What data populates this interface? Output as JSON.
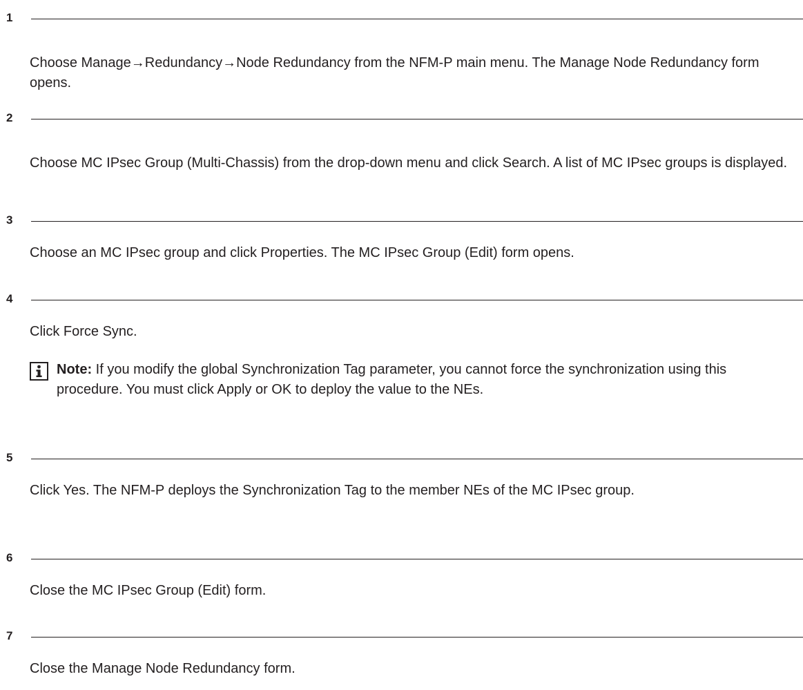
{
  "steps": [
    {
      "number": "1",
      "text": "Choose Manage→Redundancy→Node Redundancy from the NFM-P main menu. The Manage Node Redundancy form opens."
    },
    {
      "number": "2",
      "text": "Choose MC IPsec Group (Multi-Chassis) from the drop-down menu and click Search. A list of MC IPsec groups is displayed."
    },
    {
      "number": "3",
      "text": "Choose an MC IPsec group and click Properties. The MC IPsec Group (Edit) form opens."
    },
    {
      "number": "4",
      "text": "Click Force Sync.",
      "note": {
        "icon": "info-icon",
        "label": "Note:",
        "text": " If you modify the global Synchronization Tag parameter, you cannot force the synchronization using this procedure. You must click Apply or OK to deploy the value to the NEs."
      }
    },
    {
      "number": "5",
      "text": "Click Yes. The NFM-P deploys the Synchronization Tag to the member NEs of the MC IPsec group."
    },
    {
      "number": "6",
      "text": "Close the MC IPsec Group (Edit) form."
    },
    {
      "number": "7",
      "text": "Close the Manage Node Redundancy form."
    }
  ]
}
